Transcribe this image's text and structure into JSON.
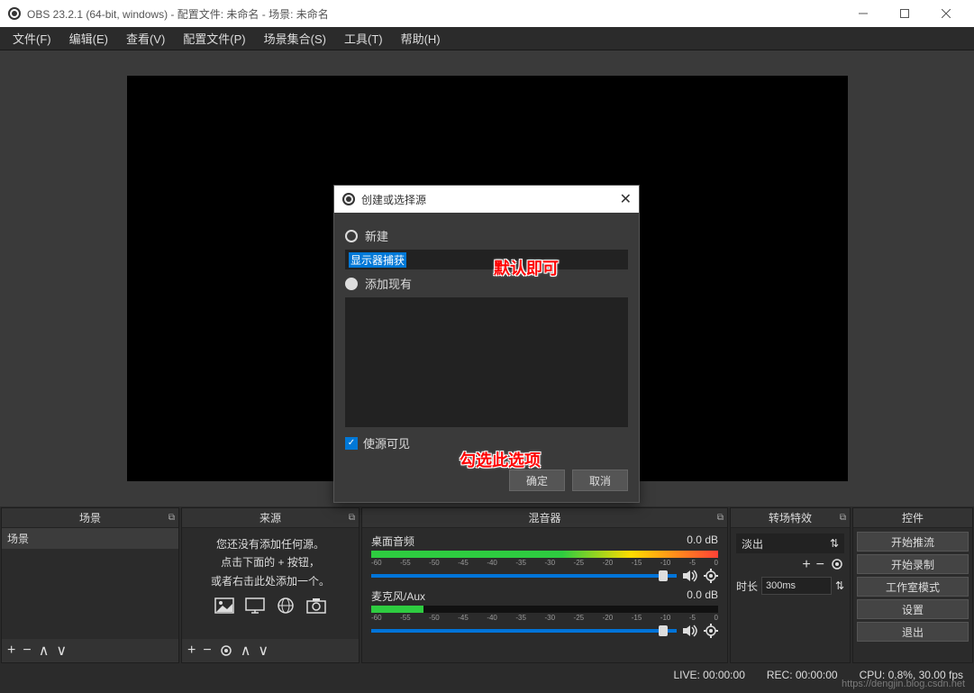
{
  "window": {
    "title": "OBS 23.2.1 (64-bit, windows) - 配置文件: 未命名 - 场景: 未命名"
  },
  "menu": {
    "file": "文件(F)",
    "edit": "编辑(E)",
    "view": "查看(V)",
    "profile": "配置文件(P)",
    "scene_collection": "场景集合(S)",
    "tools": "工具(T)",
    "help": "帮助(H)"
  },
  "panels": {
    "scenes": {
      "title": "场景",
      "items": [
        "场景"
      ]
    },
    "sources": {
      "title": "来源",
      "empty_l1": "您还没有添加任何源。",
      "empty_l2": "点击下面的 + 按钮，",
      "empty_l3": "或者右击此处添加一个。"
    },
    "mixer": {
      "title": "混音器",
      "desktop_label": "桌面音频",
      "desktop_db": "0.0 dB",
      "mic_label": "麦克风/Aux",
      "mic_db": "0.0 dB",
      "scale": [
        "-60",
        "-55",
        "-50",
        "-45",
        "-40",
        "-35",
        "-30",
        "-25",
        "-20",
        "-15",
        "-10",
        "-5",
        "0"
      ]
    },
    "transitions": {
      "title": "转场特效",
      "selected": "淡出",
      "duration_label": "时长",
      "duration_value": "300ms"
    },
    "controls": {
      "title": "控件",
      "start_stream": "开始推流",
      "start_record": "开始录制",
      "studio_mode": "工作室模式",
      "settings": "设置",
      "exit": "退出"
    }
  },
  "statusbar": {
    "live": "LIVE: 00:00:00",
    "rec": "REC: 00:00:00",
    "cpu": "CPU: 0.8%, 30.00 fps"
  },
  "dialog": {
    "title": "创建或选择源",
    "radio_new": "新建",
    "new_value": "显示器捕获",
    "radio_existing": "添加现有",
    "checkbox_visible": "使源可见",
    "ok": "确定",
    "cancel": "取消"
  },
  "annotations": {
    "a1": "默认即可",
    "a2": "勾选此选项"
  },
  "watermark": "https://dengjin.blog.csdn.net"
}
